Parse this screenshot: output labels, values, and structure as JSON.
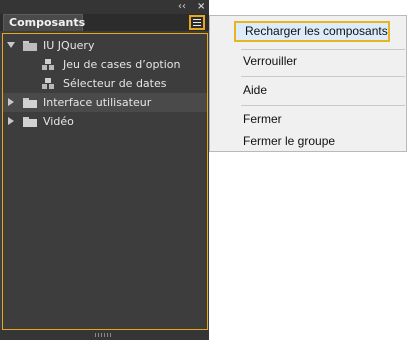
{
  "panel": {
    "collapse_glyph": "‹‹",
    "close_glyph": "×",
    "tab_label": "Composants",
    "menu_icon": "panel-menu-icon"
  },
  "tree": [
    {
      "label": "IU JQuery",
      "type": "folder",
      "expanded": true,
      "level": 0
    },
    {
      "label": "Jeu de cases d’option",
      "type": "component",
      "level": 1
    },
    {
      "label": "Sélecteur de dates",
      "type": "component",
      "level": 1
    },
    {
      "label": "Interface utilisateur",
      "type": "folder",
      "expanded": false,
      "level": 0,
      "selected": true
    },
    {
      "label": "Vidéo",
      "type": "folder",
      "expanded": false,
      "level": 0
    }
  ],
  "context_menu": {
    "items": [
      "Recharger les composants",
      "Verrouiller",
      "Aide",
      "Fermer",
      "Fermer le groupe"
    ]
  },
  "colors": {
    "highlight_border": "#e6a81e",
    "panel_bg": "#3d3d3d",
    "menu_bg": "#f0f0f0",
    "menu_hover": "#dcecfb"
  }
}
